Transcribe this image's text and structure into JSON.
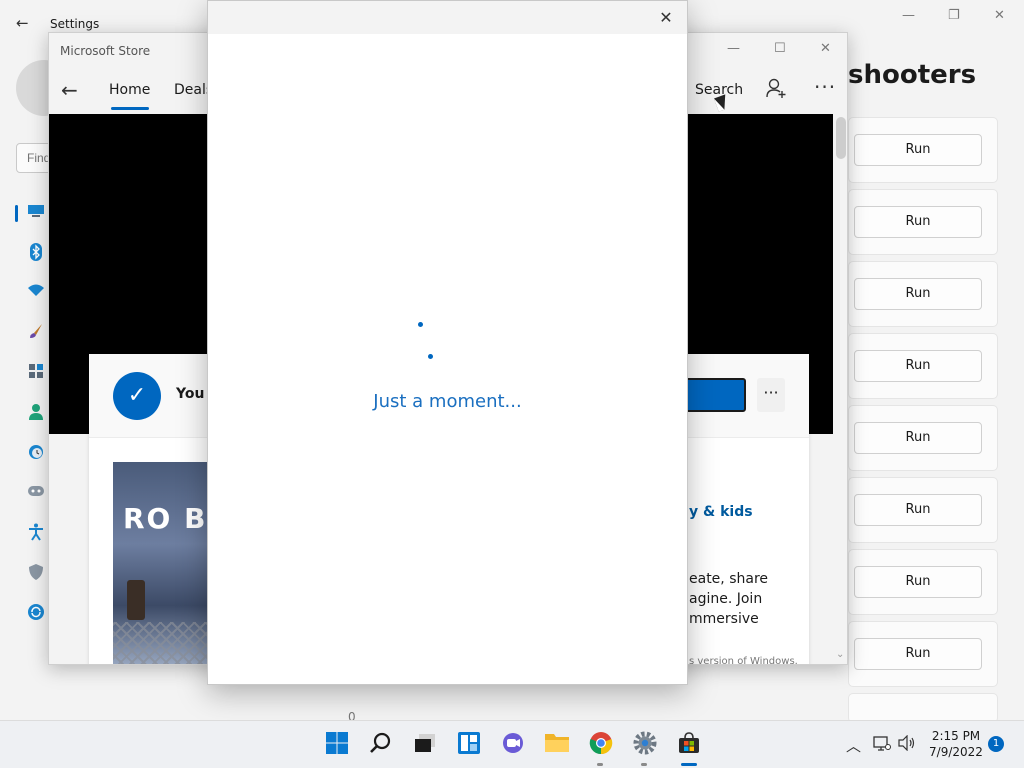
{
  "settings": {
    "title": "Settings",
    "back_icon": "←",
    "minimize_icon": "—",
    "restore_icon": "❐",
    "close_icon": "✕",
    "search_placeholder": "Find",
    "page_heading": "shooters",
    "run_label": "Run",
    "bottom_text": "0",
    "sidebar_icons": [
      "display-icon",
      "bluetooth-icon",
      "wifi-icon",
      "brush-icon",
      "apps-icon",
      "accounts-icon",
      "time-icon",
      "gaming-icon",
      "accessibility-icon",
      "shield-icon",
      "update-icon"
    ]
  },
  "store": {
    "title": "Microsoft Store",
    "nav": {
      "home": "Home",
      "deals": "Deals"
    },
    "search_label": "Search",
    "more_icon": "···",
    "card": {
      "message": "You c",
      "more_icon": "···",
      "category": "y & kids",
      "description_lines": [
        "eate, share",
        "agine. Join",
        "mmersive"
      ],
      "legal": "s version of Windows.",
      "thumb_logo": "RO B"
    }
  },
  "modal": {
    "close_icon": "✕",
    "message": "Just a moment..."
  },
  "taskbar": {
    "time": "2:15 PM",
    "date": "7/9/2022",
    "notification_count": "1",
    "accent": "#0067c0"
  }
}
